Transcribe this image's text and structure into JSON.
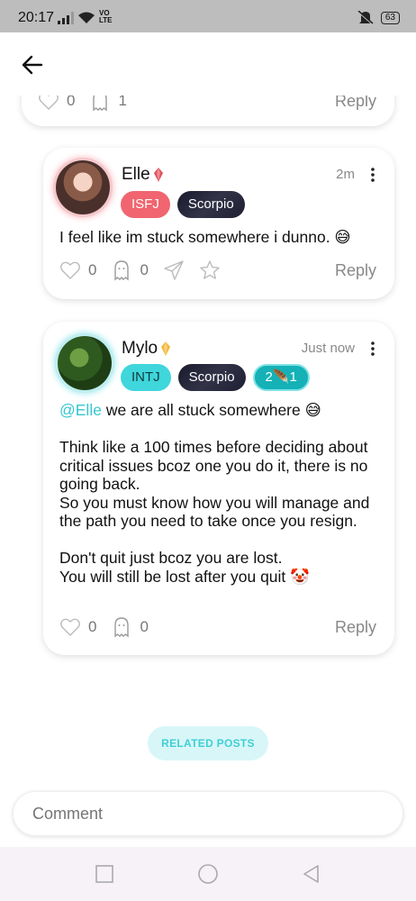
{
  "status_bar": {
    "time": "20:17",
    "network": "VO LTE",
    "battery": "63",
    "icons": [
      "signal-icon",
      "wifi-icon",
      "mute-icon",
      "battery-icon"
    ]
  },
  "top_bar": {
    "back_icon": "arrow-left-icon"
  },
  "previous_comment": {
    "likes": "0",
    "ghosts": "1",
    "reply_label": "Reply"
  },
  "comments": [
    {
      "username": "Elle",
      "badge": "gem-icon",
      "badge_color": "#e0525c",
      "time": "2m",
      "tags": [
        "ISFJ",
        "Scorpio"
      ],
      "text": "I feel like im stuck somewhere i dunno. 😅",
      "likes": "0",
      "ghosts": "0",
      "reply_label": "Reply"
    },
    {
      "username": "Mylo",
      "badge": "gem-icon",
      "badge_color": "#f3b63a",
      "time": "Just now",
      "tags": [
        "INTJ",
        "Scorpio",
        "2🪶1"
      ],
      "mention": "@Elle",
      "text": " we are all stuck somewhere 😅\n\nThink like a 100 times before deciding about critical issues bcoz one you do it, there is no going back.\nSo you must know how you will manage and the path you need to take once you resign.\n\nDon't quit just bcoz you are lost.\nYou will still be lost after you quit 🤡",
      "likes": "0",
      "ghosts": "0",
      "reply_label": "Reply"
    }
  ],
  "related_posts_label": "RELATED POSTS",
  "comment_input": {
    "placeholder": "Comment"
  },
  "nav_bar": {
    "icons": [
      "square-icon",
      "circle-icon",
      "triangle-back-icon"
    ]
  },
  "colors": {
    "accent": "#3fd6dc",
    "isfj": "#f0656f",
    "intj": "#3fd6dc"
  }
}
